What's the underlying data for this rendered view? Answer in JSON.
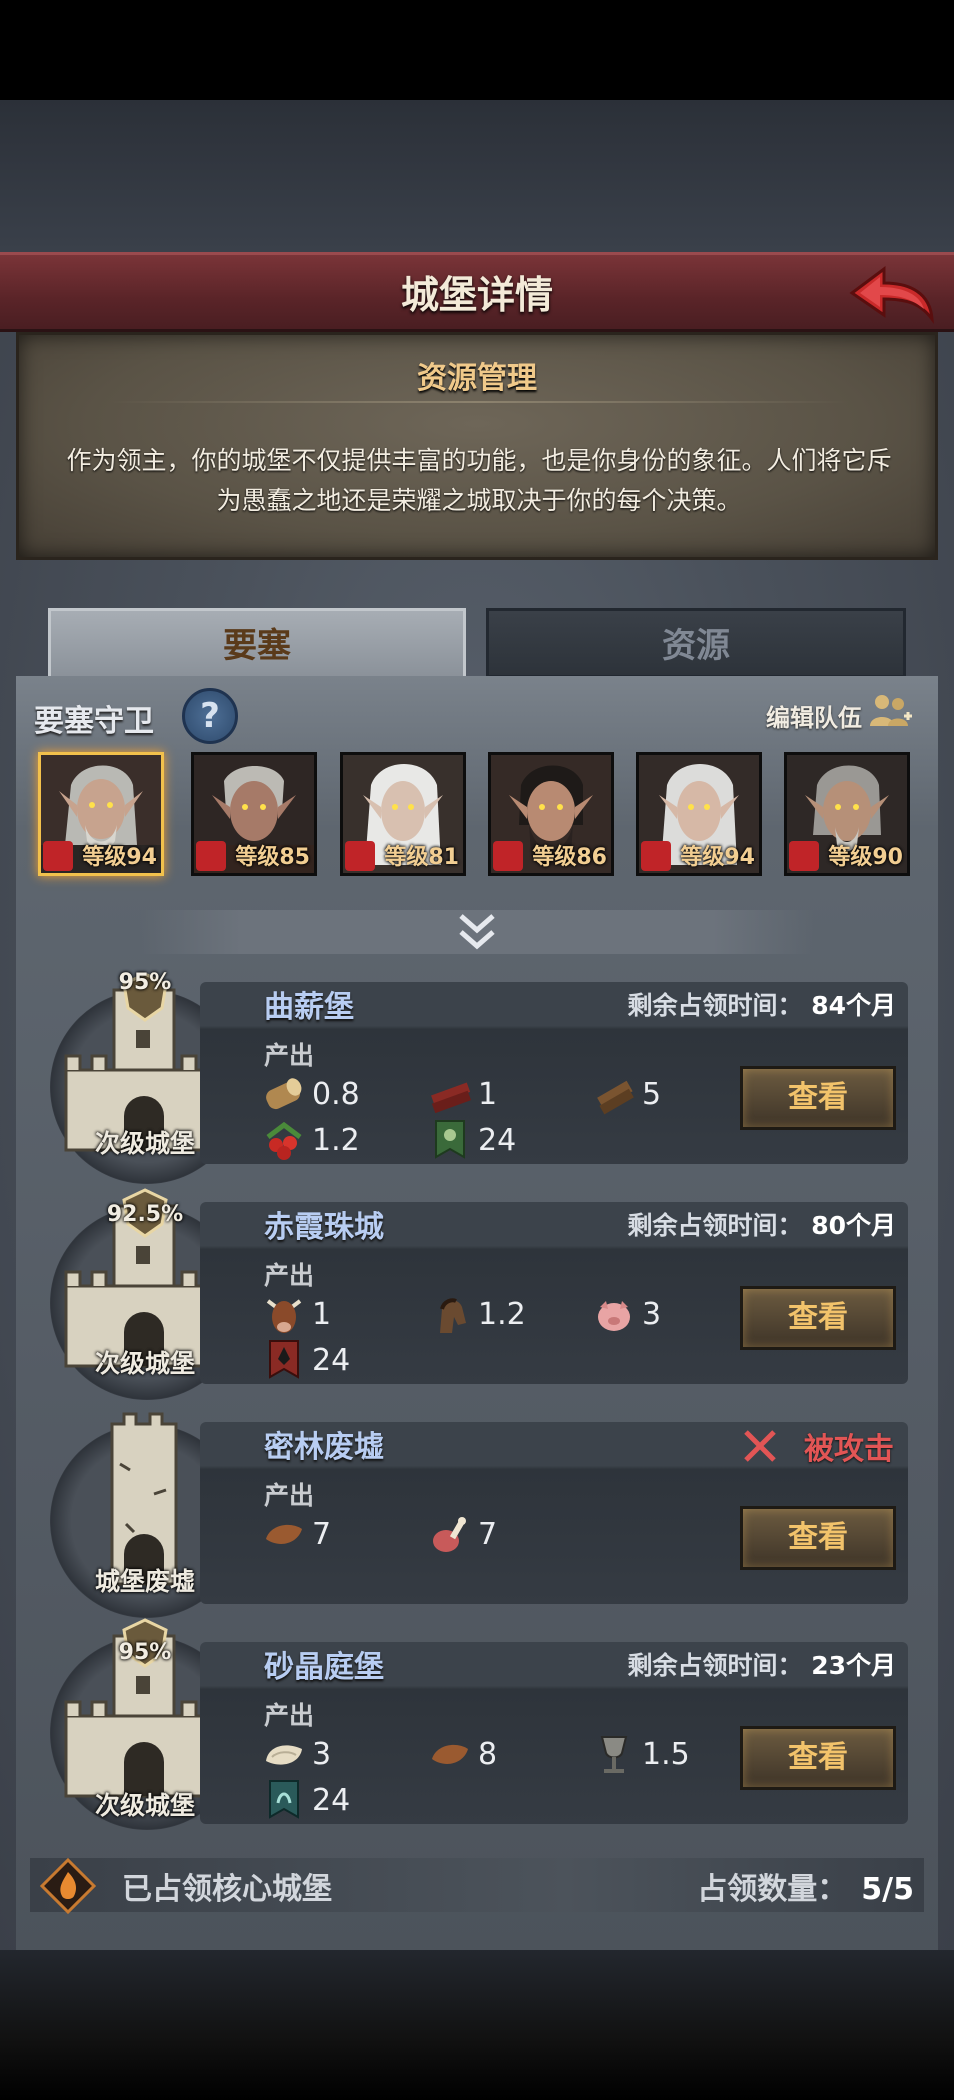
{
  "header": {
    "title": "城堡详情"
  },
  "info": {
    "title": "资源管理",
    "text": "作为领主，你的城堡不仅提供丰富的功能，也是你身份的象征。人们将它斥为愚蠢之地还是荣耀之城取决于你的每个决策。"
  },
  "tabs": [
    {
      "label": "要塞"
    },
    {
      "label": "资源"
    }
  ],
  "guards": {
    "label": "要塞守卫",
    "help": "?",
    "edit_label": "编辑队伍",
    "heroes": [
      {
        "level": "等级94",
        "selected": true
      },
      {
        "level": "等级85"
      },
      {
        "level": "等级81"
      },
      {
        "level": "等级86"
      },
      {
        "level": "等级94"
      },
      {
        "level": "等级90"
      }
    ]
  },
  "castles": [
    {
      "name": "曲薪堡",
      "type": "次级城堡",
      "pct": "95%",
      "time_label": "剩余占领时间：",
      "time_value": "84个月",
      "output_label": "产出",
      "resources": [
        {
          "icon": "wood-log-icon",
          "value": "0.8"
        },
        {
          "icon": "red-plank-icon",
          "value": "1"
        },
        {
          "icon": "wood-plank-icon",
          "value": "5"
        },
        {
          "icon": "berries-icon",
          "value": "1.2"
        },
        {
          "icon": "green-banner-icon",
          "value": "24"
        }
      ],
      "button": "查看"
    },
    {
      "name": "赤霞珠城",
      "type": "次级城堡",
      "pct": "92.5%",
      "time_label": "剩余占领时间：",
      "time_value": "80个月",
      "output_label": "产出",
      "resources": [
        {
          "icon": "cow-icon",
          "value": "1"
        },
        {
          "icon": "horse-icon",
          "value": "1.2"
        },
        {
          "icon": "pig-icon",
          "value": "3"
        },
        {
          "icon": "red-banner-icon",
          "value": "24"
        }
      ],
      "button": "查看"
    },
    {
      "name": "密林废墟",
      "type": "城堡废墟",
      "status": "被攻击",
      "output_label": "产出",
      "resources": [
        {
          "icon": "leather-icon",
          "value": "7"
        },
        {
          "icon": "meat-icon",
          "value": "7"
        }
      ],
      "button": "查看"
    },
    {
      "name": "砂晶庭堡",
      "type": "次级城堡",
      "pct": "95%",
      "time_label": "剩余占领时间：",
      "time_value": "23个月",
      "output_label": "产出",
      "resources": [
        {
          "icon": "fleece-icon",
          "value": "3"
        },
        {
          "icon": "leather-icon",
          "value": "8"
        },
        {
          "icon": "goblet-icon",
          "value": "1.5"
        },
        {
          "icon": "teal-banner-icon",
          "value": "24"
        }
      ],
      "button": "查看"
    }
  ],
  "footer": {
    "label": "已占领核心城堡",
    "count_label": "占领数量：",
    "count_value": "5/5"
  },
  "colors": {
    "accent": "#f3c36b",
    "name": "#b8cdf2",
    "danger": "#e25555"
  }
}
